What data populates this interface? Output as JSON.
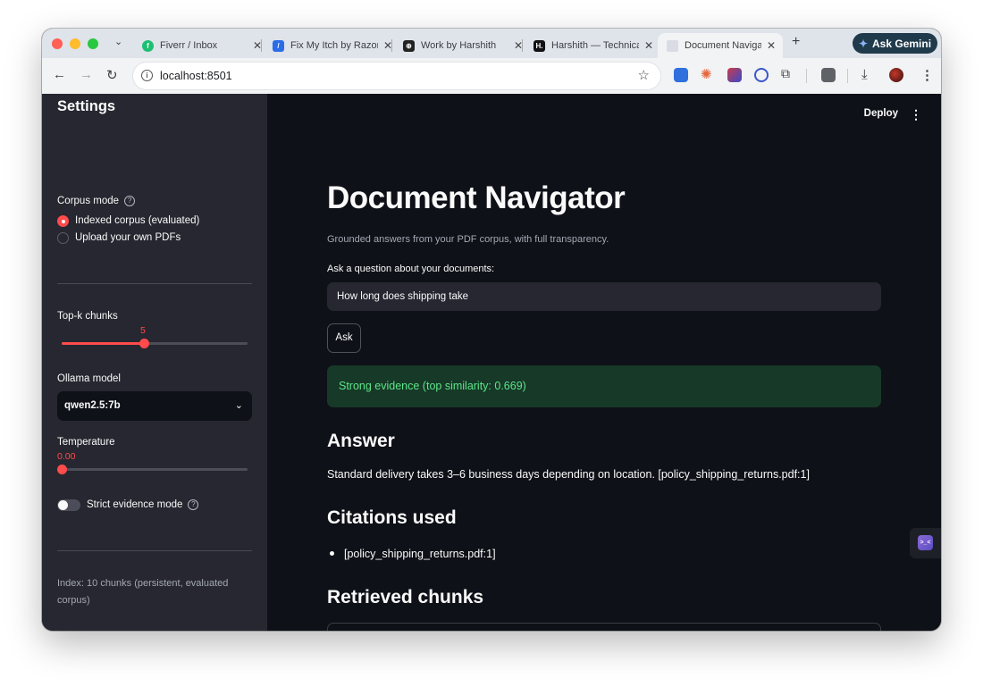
{
  "browser": {
    "tabs": [
      {
        "title": "Fiverr / Inbox",
        "active": false
      },
      {
        "title": "Fix My Itch by Razor",
        "active": false
      },
      {
        "title": "Work by Harshith",
        "active": false
      },
      {
        "title": "Harshith — Technical",
        "active": false
      },
      {
        "title": "Document Navigator",
        "active": true
      }
    ],
    "new_tab_symbol": "+",
    "ask_gemini": "Ask Gemini",
    "url": "localhost:8501",
    "colors": {
      "chrome": "#dfe3ea",
      "toolbar": "#f1f3f4"
    }
  },
  "header": {
    "deploy": "Deploy"
  },
  "sidebar": {
    "title": "Settings",
    "corpus_mode": {
      "label": "Corpus mode",
      "options": [
        "Indexed corpus (evaluated)",
        "Upload your own PDFs"
      ],
      "selected": 0
    },
    "topk": {
      "label": "Top-k chunks",
      "value": "5",
      "min": 1,
      "max": 10
    },
    "model": {
      "label": "Ollama model",
      "value": "qwen2.5:7b"
    },
    "temperature": {
      "label": "Temperature",
      "value": "0.00",
      "min": 0.0,
      "max": 1.0
    },
    "strict": {
      "label": "Strict evidence mode",
      "on": false
    },
    "footnote": "Index: 10 chunks (persistent, evaluated corpus)"
  },
  "main": {
    "title": "Document Navigator",
    "subtitle": "Grounded answers from your PDF corpus, with full transparency.",
    "question_label": "Ask a question about your documents:",
    "question_value": "How long does shipping take",
    "ask_button": "Ask",
    "evidence_banner": "Strong evidence (top similarity: 0.669)",
    "answer_heading": "Answer",
    "answer_text": "Standard delivery takes 3–6 business days depending on location. [policy_shipping_returns.pdf:1]",
    "citations_heading": "Citations used",
    "citations": [
      "[policy_shipping_returns.pdf:1]"
    ],
    "retrieved_heading": "Retrieved chunks"
  },
  "theme": {
    "accent": "#ff4b4b",
    "success_text": "#5ce488",
    "success_bg": "#173928",
    "sidebar_bg": "#262730",
    "main_bg": "#0e1117"
  }
}
